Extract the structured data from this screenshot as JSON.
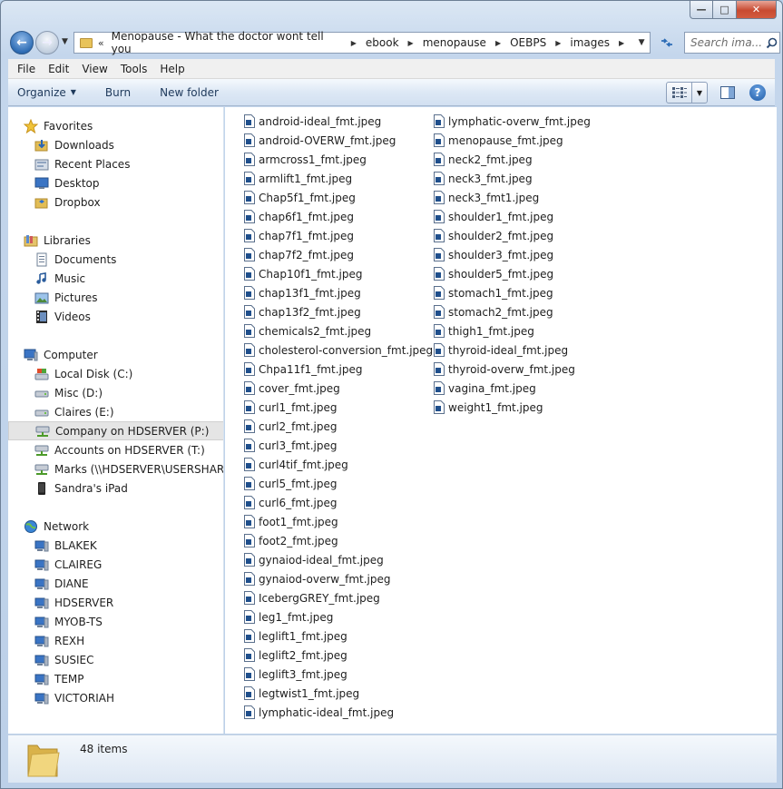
{
  "window": {
    "caption": {
      "minimize": "—",
      "maximize": "□",
      "close": "✕"
    }
  },
  "address_bar": {
    "overflow": "«",
    "crumbs": [
      "Menopause - What the doctor wont tell you",
      "ebook",
      "menopause",
      "OEBPS",
      "images"
    ]
  },
  "search": {
    "placeholder": "Search ima..."
  },
  "menu": [
    "File",
    "Edit",
    "View",
    "Tools",
    "Help"
  ],
  "toolbar": {
    "organize": "Organize",
    "burn": "Burn",
    "new_folder": "New folder"
  },
  "nav": {
    "favorites": {
      "label": "Favorites",
      "items": [
        "Downloads",
        "Recent Places",
        "Desktop",
        "Dropbox"
      ]
    },
    "libraries": {
      "label": "Libraries",
      "items": [
        "Documents",
        "Music",
        "Pictures",
        "Videos"
      ]
    },
    "computer": {
      "label": "Computer",
      "items": [
        "Local Disk (C:)",
        "Misc (D:)",
        "Claires (E:)",
        "Company on HDSERVER (P:)",
        "Accounts on HDSERVER (T:)",
        "Marks (\\\\HDSERVER\\USERSHARES)",
        "Sandra's iPad"
      ],
      "selected": "Company on HDSERVER (P:)"
    },
    "network": {
      "label": "Network",
      "items": [
        "BLAKEK",
        "CLAIREG",
        "DIANE",
        "HDSERVER",
        "MYOB-TS",
        "REXH",
        "SUSIEC",
        "TEMP",
        "VICTORIAH"
      ]
    }
  },
  "files": {
    "column1": [
      "android-ideal_fmt.jpeg",
      "android-OVERW_fmt.jpeg",
      "armcross1_fmt.jpeg",
      "armlift1_fmt.jpeg",
      "Chap5f1_fmt.jpeg",
      "chap6f1_fmt.jpeg",
      "chap7f1_fmt.jpeg",
      "chap7f2_fmt.jpeg",
      "Chap10f1_fmt.jpeg",
      "chap13f1_fmt.jpeg",
      "chap13f2_fmt.jpeg",
      "chemicals2_fmt.jpeg",
      "cholesterol-conversion_fmt.jpeg",
      "Chpa11f1_fmt.jpeg",
      "cover_fmt.jpeg",
      "curl1_fmt.jpeg",
      "curl2_fmt.jpeg",
      "curl3_fmt.jpeg",
      "curl4tif_fmt.jpeg",
      "curl5_fmt.jpeg",
      "curl6_fmt.jpeg",
      "foot1_fmt.jpeg",
      "foot2_fmt.jpeg",
      "gynaiod-ideal_fmt.jpeg",
      "gynaiod-overw_fmt.jpeg",
      "IcebergGREY_fmt.jpeg",
      "leg1_fmt.jpeg",
      "leglift1_fmt.jpeg",
      "leglift2_fmt.jpeg",
      "leglift3_fmt.jpeg",
      "legtwist1_fmt.jpeg",
      "lymphatic-ideal_fmt.jpeg"
    ],
    "column2": [
      "lymphatic-overw_fmt.jpeg",
      "menopause_fmt.jpeg",
      "neck2_fmt.jpeg",
      "neck3_fmt.jpeg",
      "neck3_fmt1.jpeg",
      "shoulder1_fmt.jpeg",
      "shoulder2_fmt.jpeg",
      "shoulder3_fmt.jpeg",
      "shoulder5_fmt.jpeg",
      "stomach1_fmt.jpeg",
      "stomach2_fmt.jpeg",
      "thigh1_fmt.jpeg",
      "thyroid-ideal_fmt.jpeg",
      "thyroid-overw_fmt.jpeg",
      "vagina_fmt.jpeg",
      "weight1_fmt.jpeg"
    ]
  },
  "status": {
    "item_count": "48 items"
  }
}
